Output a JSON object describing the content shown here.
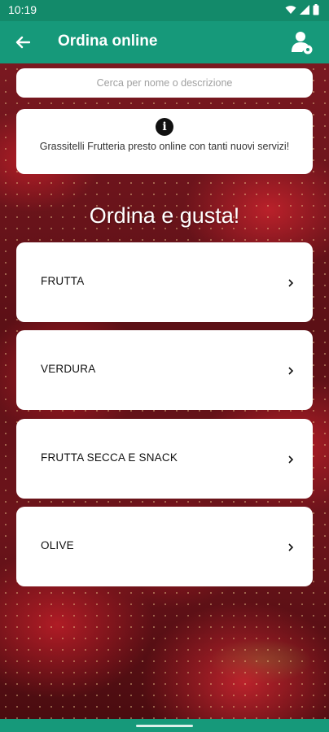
{
  "status_bar": {
    "time": "10:19"
  },
  "app_bar": {
    "title": "Ordina online"
  },
  "search": {
    "placeholder": "Cerca per nome o descrizione"
  },
  "info": {
    "message": "Grassitelli Frutteria presto online con tanti nuovi servizi!"
  },
  "headline": "Ordina e gusta!",
  "categories": [
    {
      "label": "FRUTTA"
    },
    {
      "label": "VERDURA"
    },
    {
      "label": "FRUTTA SECCA E SNACK"
    },
    {
      "label": "OLIVE"
    }
  ],
  "icons": {
    "back": "arrow-left-icon",
    "account": "user-settings-icon",
    "info": "info-icon",
    "chevron": "chevron-right-icon"
  },
  "colors": {
    "primary": "#16997a",
    "status_bar": "#138a6a",
    "card": "#ffffff"
  }
}
